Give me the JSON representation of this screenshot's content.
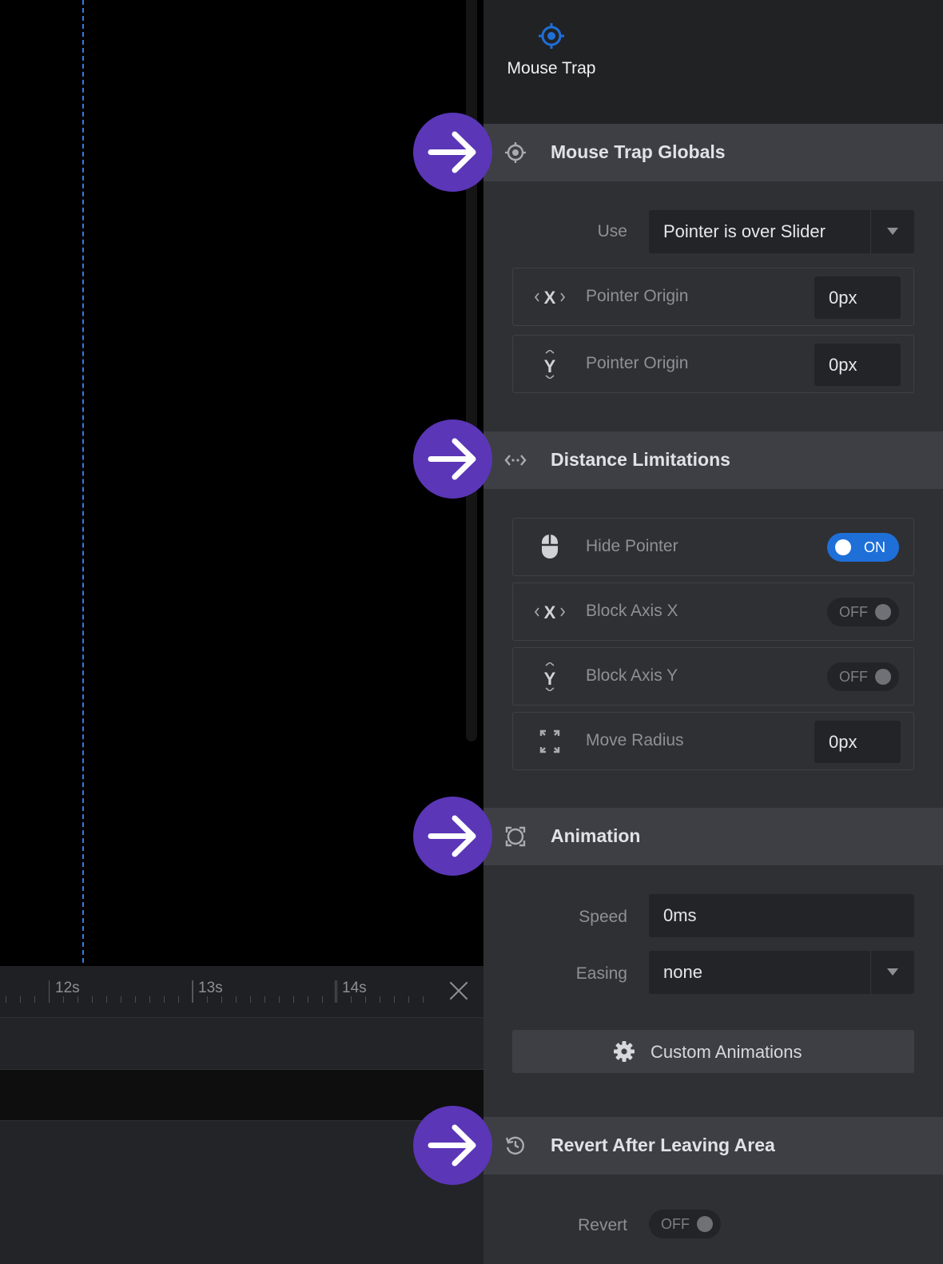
{
  "timeline": {
    "ticks": [
      "12s",
      "13s",
      "14s"
    ]
  },
  "panel": {
    "title": "Mouse Trap",
    "sections": {
      "globals": {
        "title": "Mouse Trap Globals",
        "use_label": "Use",
        "use_value": "Pointer is over Slider",
        "pointer_x_label": "Pointer Origin",
        "pointer_x_value": "0px",
        "pointer_y_label": "Pointer Origin",
        "pointer_y_value": "0px"
      },
      "distance": {
        "title": "Distance Limitations",
        "hide_pointer_label": "Hide Pointer",
        "hide_pointer_state": "ON",
        "block_x_label": "Block Axis X",
        "block_x_state": "OFF",
        "block_y_label": "Block Axis Y",
        "block_y_state": "OFF",
        "radius_label": "Move Radius",
        "radius_value": "0px"
      },
      "animation": {
        "title": "Animation",
        "speed_label": "Speed",
        "speed_value": "0ms",
        "easing_label": "Easing",
        "easing_value": "none",
        "custom_button": "Custom Animations"
      },
      "revert": {
        "title": "Revert After Leaving Area",
        "revert_label": "Revert",
        "revert_state": "OFF"
      }
    }
  },
  "colors": {
    "accent": "#1f6fd8",
    "callout": "#5b36b7",
    "playhead": "#2f7de1"
  },
  "icons": [
    "crosshair-icon",
    "arrow-right-icon",
    "axis-x-icon",
    "axis-y-icon",
    "horizontal-arrows-icon",
    "mouse-icon",
    "expand-icon",
    "animation-icon",
    "gear-icon",
    "revert-icon",
    "close-icon"
  ]
}
